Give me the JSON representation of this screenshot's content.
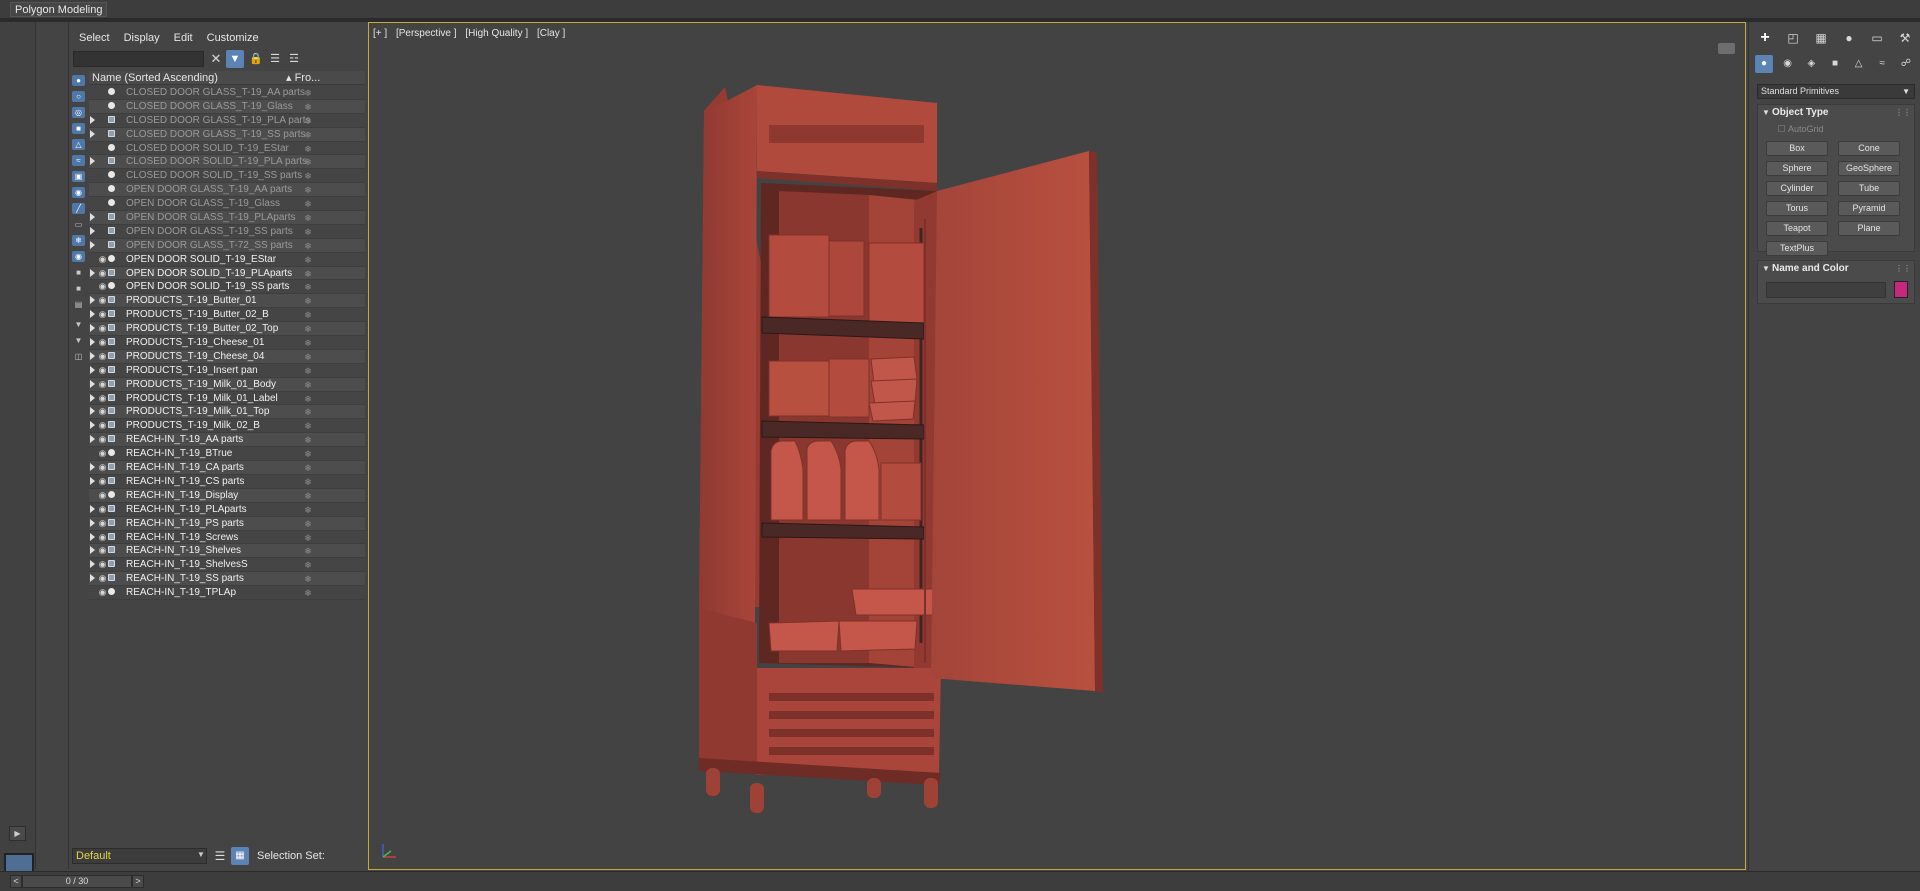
{
  "ribbon": {
    "tab": "Polygon Modeling"
  },
  "explorer": {
    "menu": [
      "Select",
      "Display",
      "Edit",
      "Customize"
    ],
    "search_value": "",
    "column_name": "Name (Sorted Ascending)",
    "column_frozen": "▴ Fro...",
    "rows": [
      {
        "name": "CLOSED DOOR GLASS_T-19_AA parts",
        "expand": false,
        "visible": false,
        "group": false
      },
      {
        "name": "CLOSED DOOR GLASS_T-19_Glass",
        "expand": false,
        "visible": false,
        "group": false
      },
      {
        "name": "CLOSED DOOR GLASS_T-19_PLA parts",
        "expand": true,
        "visible": false,
        "group": true
      },
      {
        "name": "CLOSED DOOR GLASS_T-19_SS parts",
        "expand": true,
        "visible": false,
        "group": true
      },
      {
        "name": "CLOSED DOOR SOLID_T-19_EStar",
        "expand": false,
        "visible": false,
        "group": false
      },
      {
        "name": "CLOSED DOOR SOLID_T-19_PLA parts",
        "expand": true,
        "visible": false,
        "group": true
      },
      {
        "name": "CLOSED DOOR SOLID_T-19_SS parts",
        "expand": false,
        "visible": false,
        "group": false
      },
      {
        "name": "OPEN DOOR GLASS_T-19_AA parts",
        "expand": false,
        "visible": false,
        "group": false
      },
      {
        "name": "OPEN DOOR GLASS_T-19_Glass",
        "expand": false,
        "visible": false,
        "group": false
      },
      {
        "name": "OPEN DOOR GLASS_T-19_PLAparts",
        "expand": true,
        "visible": false,
        "group": true
      },
      {
        "name": "OPEN DOOR GLASS_T-19_SS parts",
        "expand": true,
        "visible": false,
        "group": true
      },
      {
        "name": "OPEN DOOR GLASS_T-72_SS parts",
        "expand": true,
        "visible": false,
        "group": true
      },
      {
        "name": "OPEN DOOR SOLID_T-19_EStar",
        "expand": false,
        "visible": true,
        "group": false
      },
      {
        "name": "OPEN DOOR SOLID_T-19_PLAparts",
        "expand": true,
        "visible": true,
        "group": true
      },
      {
        "name": "OPEN DOOR SOLID_T-19_SS parts",
        "expand": false,
        "visible": true,
        "group": false
      },
      {
        "name": "PRODUCTS_T-19_Butter_01",
        "expand": true,
        "visible": true,
        "group": true
      },
      {
        "name": "PRODUCTS_T-19_Butter_02_B",
        "expand": true,
        "visible": true,
        "group": true
      },
      {
        "name": "PRODUCTS_T-19_Butter_02_Top",
        "expand": true,
        "visible": true,
        "group": true
      },
      {
        "name": "PRODUCTS_T-19_Cheese_01",
        "expand": true,
        "visible": true,
        "group": true
      },
      {
        "name": "PRODUCTS_T-19_Cheese_04",
        "expand": true,
        "visible": true,
        "group": true
      },
      {
        "name": "PRODUCTS_T-19_Insert pan",
        "expand": true,
        "visible": true,
        "group": true
      },
      {
        "name": "PRODUCTS_T-19_Milk_01_Body",
        "expand": true,
        "visible": true,
        "group": true
      },
      {
        "name": "PRODUCTS_T-19_Milk_01_Label",
        "expand": true,
        "visible": true,
        "group": true
      },
      {
        "name": "PRODUCTS_T-19_Milk_01_Top",
        "expand": true,
        "visible": true,
        "group": true
      },
      {
        "name": "PRODUCTS_T-19_Milk_02_B",
        "expand": true,
        "visible": true,
        "group": true
      },
      {
        "name": "REACH-IN_T-19_AA parts",
        "expand": true,
        "visible": true,
        "group": true
      },
      {
        "name": "REACH-IN_T-19_BTrue",
        "expand": false,
        "visible": true,
        "group": false
      },
      {
        "name": "REACH-IN_T-19_CA parts",
        "expand": true,
        "visible": true,
        "group": true
      },
      {
        "name": "REACH-IN_T-19_CS parts",
        "expand": true,
        "visible": true,
        "group": true
      },
      {
        "name": "REACH-IN_T-19_Display",
        "expand": false,
        "visible": true,
        "group": false
      },
      {
        "name": "REACH-IN_T-19_PLAparts",
        "expand": true,
        "visible": true,
        "group": true
      },
      {
        "name": "REACH-IN_T-19_PS parts",
        "expand": true,
        "visible": true,
        "group": true
      },
      {
        "name": "REACH-IN_T-19_Screws",
        "expand": true,
        "visible": true,
        "group": true
      },
      {
        "name": "REACH-IN_T-19_Shelves",
        "expand": true,
        "visible": true,
        "group": true
      },
      {
        "name": "REACH-IN_T-19_ShelvesS",
        "expand": true,
        "visible": true,
        "group": true
      },
      {
        "name": "REACH-IN_T-19_SS parts",
        "expand": true,
        "visible": true,
        "group": true
      },
      {
        "name": "REACH-IN_T-19_TPLAp",
        "expand": false,
        "visible": true,
        "group": false
      }
    ],
    "layer": "Default",
    "selection_set_label": "Selection Set:"
  },
  "timeslider": {
    "position": "0 / 30",
    "prev": "<",
    "next": ">"
  },
  "viewport": {
    "labels": [
      "[+ ]",
      "[Perspective ]",
      "[High Quality ]",
      "[Clay ]"
    ],
    "model_color": "#b2453a"
  },
  "command_panel": {
    "dropdown": "Standard Primitives",
    "object_type_title": "Object Type",
    "autogrid": "AutoGrid",
    "primitives": [
      "Box",
      "Cone",
      "Sphere",
      "GeoSphere",
      "Cylinder",
      "Tube",
      "Torus",
      "Pyramid",
      "Teapot",
      "Plane",
      "TextPlus"
    ],
    "name_color_title": "Name and Color",
    "swatch_color": "#c6287e"
  }
}
